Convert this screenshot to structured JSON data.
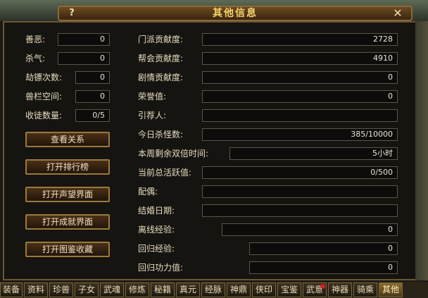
{
  "window": {
    "title": "其他信息",
    "help_label": "?",
    "close_label": "✕"
  },
  "left_fields": [
    {
      "label": "善恶:",
      "value": "0"
    },
    {
      "label": "杀气:",
      "value": "0"
    },
    {
      "label": "劫镖次数:",
      "value": "0"
    },
    {
      "label": "兽栏空间:",
      "value": "0"
    },
    {
      "label": "收徒数量:",
      "value": "0/5"
    }
  ],
  "buttons": [
    {
      "label": "查看关系"
    },
    {
      "label": "打开排行榜"
    },
    {
      "label": "打开声望界面"
    },
    {
      "label": "打开成就界面"
    },
    {
      "label": "打开图鉴收藏"
    }
  ],
  "right_fields": [
    {
      "label": "门派贡献度:",
      "value": "2728"
    },
    {
      "label": "帮会贡献度:",
      "value": "4910"
    },
    {
      "label": "剧情贡献度:",
      "value": "0"
    },
    {
      "label": "荣誉值:",
      "value": "0"
    },
    {
      "label": "引荐人:",
      "value": ""
    },
    {
      "label": "今日杀怪数:",
      "value": "385/10000"
    },
    {
      "label": "本周剩余双倍时间:",
      "value": "5小时"
    },
    {
      "label": "当前总活跃值:",
      "value": "0/500"
    },
    {
      "label": "配偶:",
      "value": ""
    },
    {
      "label": "结婚日期:",
      "value": ""
    },
    {
      "label": "离线经验:",
      "value": "0"
    },
    {
      "label": "回归经验:",
      "value": "0"
    },
    {
      "label": "回归功力值:",
      "value": "0"
    }
  ],
  "tabs": [
    {
      "label": "装备"
    },
    {
      "label": "资料"
    },
    {
      "label": "珍兽"
    },
    {
      "label": "子女"
    },
    {
      "label": "武魂"
    },
    {
      "label": "修炼"
    },
    {
      "label": "秘籍"
    },
    {
      "label": "真元"
    },
    {
      "label": "经脉"
    },
    {
      "label": "神鼎"
    },
    {
      "label": "侠印"
    },
    {
      "label": "宝鉴"
    },
    {
      "label": "武意"
    },
    {
      "label": "神器"
    },
    {
      "label": "骑乘"
    },
    {
      "label": "其他"
    }
  ],
  "active_tab": "其他",
  "tab_with_notification": "武意"
}
